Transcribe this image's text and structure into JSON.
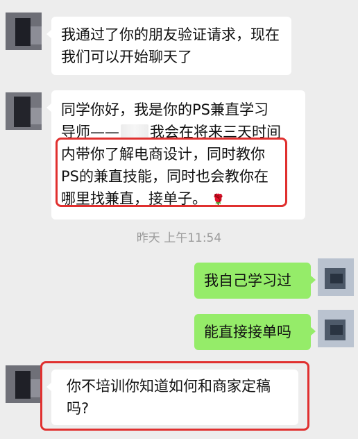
{
  "chat": {
    "messages": [
      {
        "sender": "contact",
        "lines": [
          "我通过了你的朋友验证请求，现在",
          "我们可以开始聊天了"
        ]
      },
      {
        "sender": "contact",
        "lines": [
          "同学你好，我是你的PS兼直学习",
          "导师——",
          "我会在将来三天时间",
          "内带你了解电商设计，同时教你",
          "PS的兼直技能，同时也会教你在",
          "哪里找兼直，接单子。"
        ]
      },
      {
        "sender": "me",
        "text": "我自己学习过"
      },
      {
        "sender": "me",
        "text": "能直接接单吗"
      },
      {
        "sender": "contact",
        "lines": [
          "你不培训你知道如何和商家定稿",
          "吗?"
        ]
      }
    ],
    "timestamp": "昨天 上午11:54",
    "emoji": "rose-emoji"
  },
  "colors": {
    "background": "#ededed",
    "received_bubble": "#ffffff",
    "sent_bubble": "#95ec69",
    "highlight": "#e0302f"
  }
}
